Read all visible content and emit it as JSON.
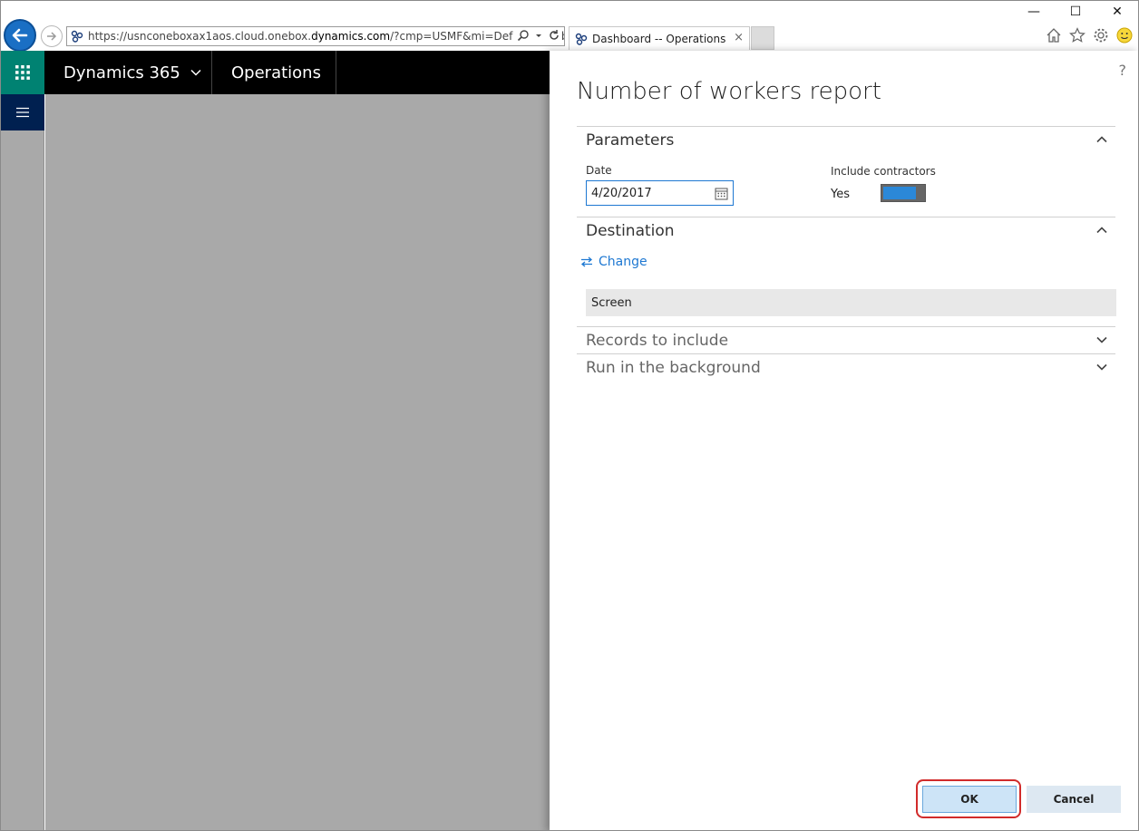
{
  "browser": {
    "url_prefix": "https://usnconeboxax1aos.cloud.onebox.",
    "url_domain": "dynamics.com",
    "url_suffix": "/?cmp=USMF&mi=DefaultDashb",
    "tab_title": "Dashboard -- Operations",
    "tab_close": "×",
    "minimize": "—",
    "maximize": "☐",
    "close": "✕"
  },
  "appbar": {
    "brand": "Dynamics 365",
    "module": "Operations"
  },
  "dialog": {
    "help": "?",
    "title": "Number of workers report",
    "parameters": {
      "heading": "Parameters",
      "date_label": "Date",
      "date_value": "4/20/2017",
      "contractors_label": "Include contractors",
      "contractors_value": "Yes",
      "contractors_on": true
    },
    "destination": {
      "heading": "Destination",
      "change_label": "Change",
      "value": "Screen"
    },
    "records_heading": "Records to include",
    "background_heading": "Run in the background",
    "ok_label": "OK",
    "cancel_label": "Cancel"
  },
  "colors": {
    "accent": "#1e78d2",
    "waffle": "#008272",
    "nav": "#002050",
    "highlight_ring": "#d12b2b"
  }
}
